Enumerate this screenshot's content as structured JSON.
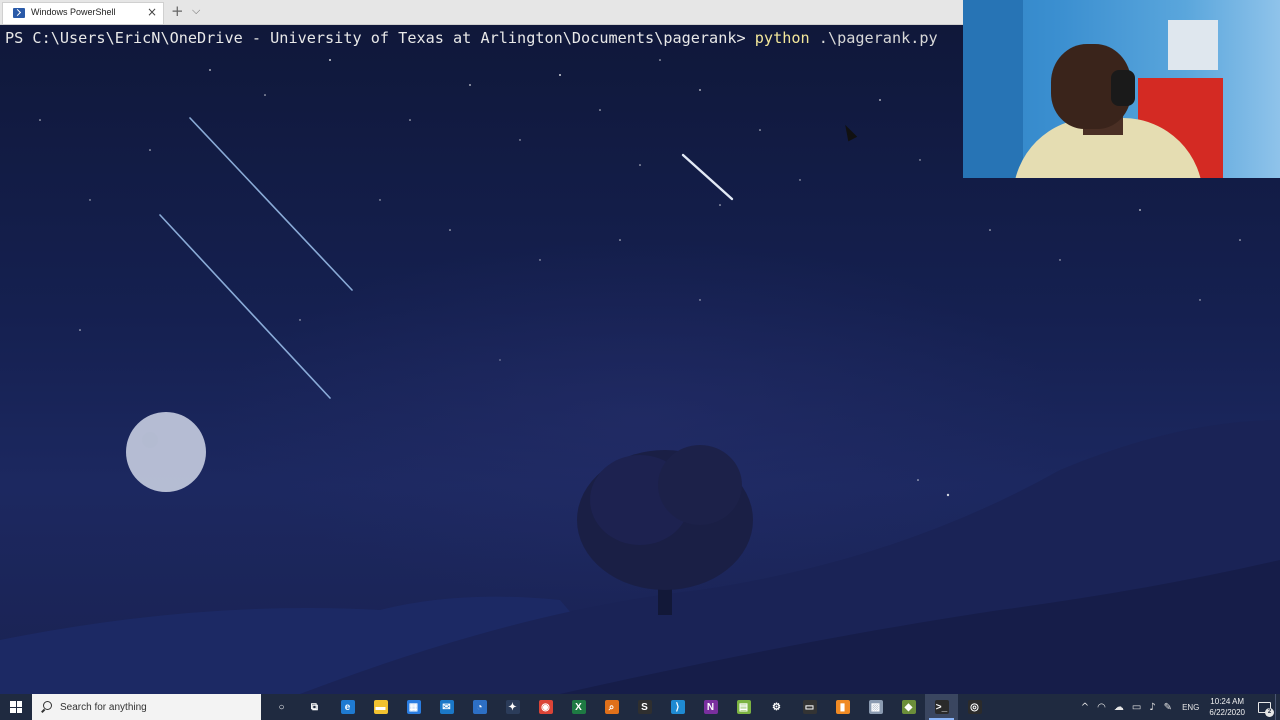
{
  "window": {
    "tab_title": "Windows PowerShell",
    "tab_close": "×",
    "new_tab": "+",
    "tab_dropdown": "⌵"
  },
  "terminal": {
    "prompt": "PS C:\\Users\\EricN\\OneDrive - University of Texas at Arlington\\Documents\\pagerank> ",
    "command": "python",
    "argument": " .\\pagerank.py"
  },
  "taskbar": {
    "search_placeholder": "Search for anything",
    "pinned_apps": [
      {
        "icon": "cortana-icon",
        "glyph": "○",
        "color": "transparent"
      },
      {
        "icon": "task-view-icon",
        "glyph": "⧉",
        "color": "transparent"
      },
      {
        "icon": "edge-icon",
        "glyph": "e",
        "color": "#1f7ad1"
      },
      {
        "icon": "file-explorer-icon",
        "glyph": "▬",
        "color": "#f2c230"
      },
      {
        "icon": "store-icon",
        "glyph": "▦",
        "color": "#2a7de1"
      },
      {
        "icon": "mail-icon",
        "glyph": "✉",
        "color": "#1b78c8"
      },
      {
        "icon": "outlook-icon",
        "glyph": "◔",
        "color": "#2d6fc4"
      },
      {
        "icon": "steam-icon",
        "glyph": "✦",
        "color": "#2b3c5a"
      },
      {
        "icon": "chrome-icon",
        "glyph": "◉",
        "color": "#db4437"
      },
      {
        "icon": "excel-icon",
        "glyph": "X",
        "color": "#1e7a43"
      },
      {
        "icon": "search-tool-icon",
        "glyph": "⌕",
        "color": "#e0701a"
      },
      {
        "icon": "skype-icon",
        "glyph": "S",
        "color": "#2f2f2f"
      },
      {
        "icon": "vscode-icon",
        "glyph": "⟩",
        "color": "#1f8ad2"
      },
      {
        "icon": "onenote-icon",
        "glyph": "N",
        "color": "#7a2f9e"
      },
      {
        "icon": "notepad-plus-icon",
        "glyph": "▤",
        "color": "#7cb342"
      },
      {
        "icon": "settings-icon",
        "glyph": "⚙",
        "color": "transparent"
      },
      {
        "icon": "terminal-dark-icon",
        "glyph": "▭",
        "color": "#333333"
      },
      {
        "icon": "sticky-notes-icon",
        "glyph": "▮",
        "color": "#f08a24"
      },
      {
        "icon": "photos-icon",
        "glyph": "▨",
        "color": "#8a9ab0"
      },
      {
        "icon": "git-icon",
        "glyph": "◆",
        "color": "#6b8e3a"
      },
      {
        "icon": "powershell-icon",
        "glyph": ">_",
        "color": "#2a2a2a"
      },
      {
        "icon": "obs-icon",
        "glyph": "◎",
        "color": "#2b2b2b"
      }
    ],
    "active_app_index": 20,
    "tray": {
      "chevron": "^",
      "language": "ENG",
      "time": "10:24 AM",
      "date": "6/22/2020",
      "notification_count": "2"
    }
  }
}
